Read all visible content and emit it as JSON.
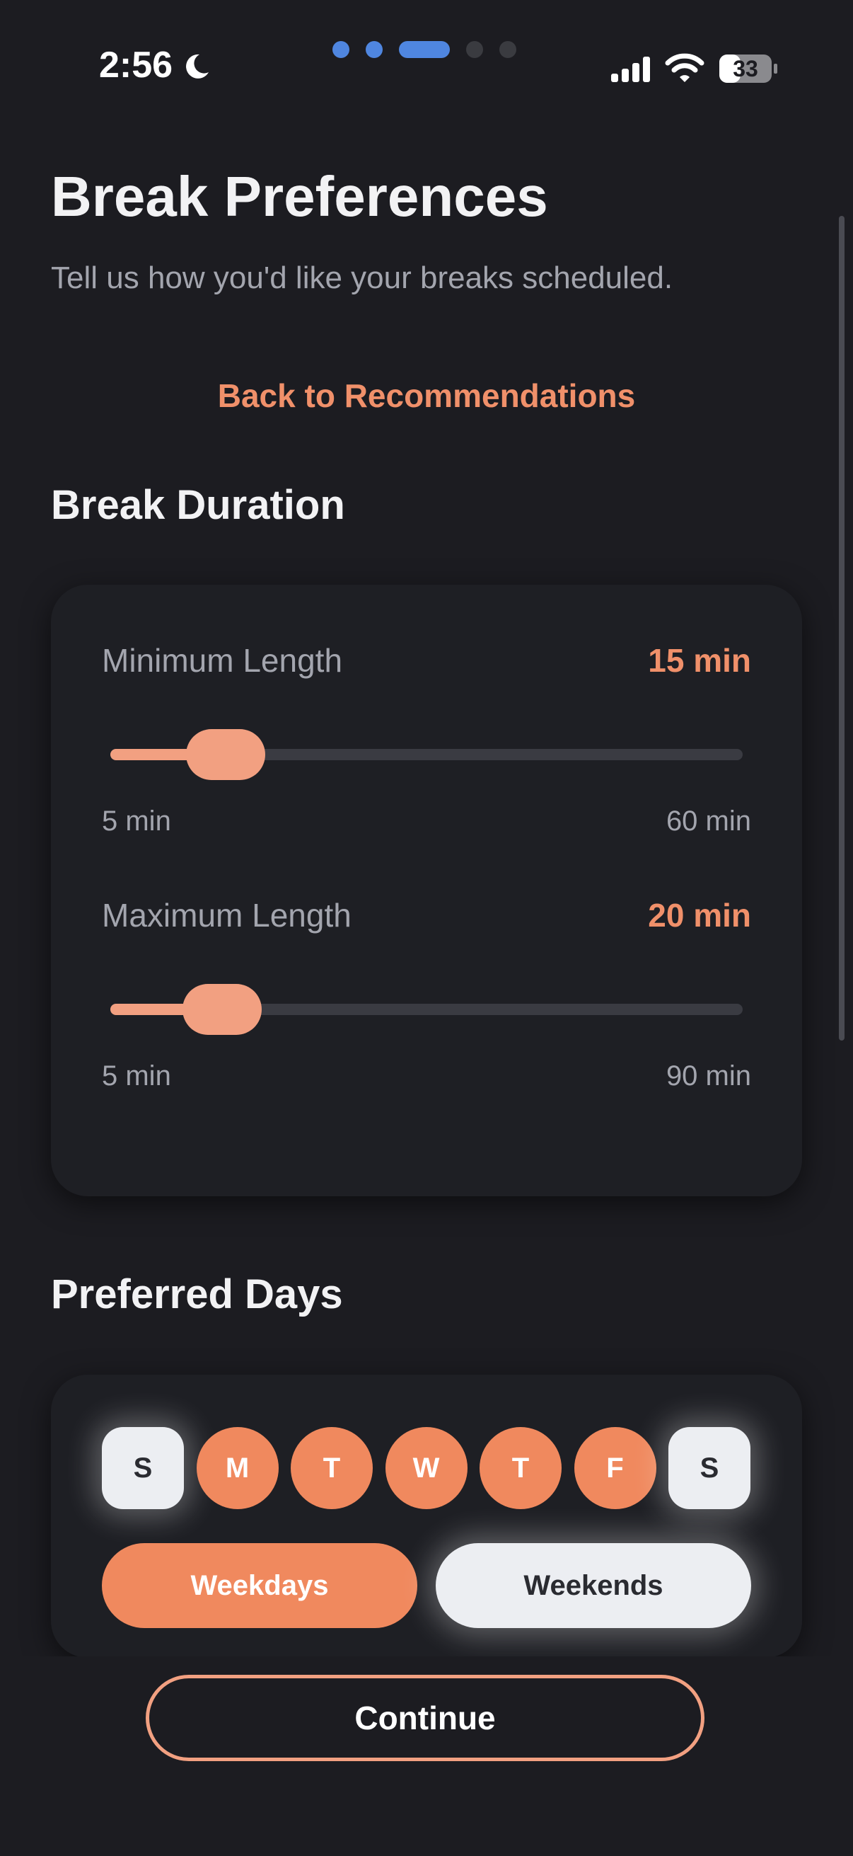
{
  "status_bar": {
    "time": "2:56",
    "battery": "33",
    "pager": [
      "done",
      "done",
      "active",
      "todo",
      "todo"
    ]
  },
  "header": {
    "title": "Break Preferences",
    "subtitle": "Tell us how you'd like your breaks scheduled.",
    "back_link": "Back to Recommendations"
  },
  "break_duration": {
    "section_title": "Break Duration",
    "minimum": {
      "label": "Minimum Length",
      "value": "15 min",
      "current": 15,
      "min": 5,
      "max": 60,
      "min_label": "5 min",
      "max_label": "60 min"
    },
    "maximum": {
      "label": "Maximum Length",
      "value": "20 min",
      "current": 20,
      "min": 5,
      "max": 90,
      "min_label": "5 min",
      "max_label": "90 min"
    }
  },
  "preferred_days": {
    "section_title": "Preferred Days",
    "days": [
      {
        "letter": "S",
        "selected": false
      },
      {
        "letter": "M",
        "selected": true
      },
      {
        "letter": "T",
        "selected": true
      },
      {
        "letter": "W",
        "selected": true
      },
      {
        "letter": "T",
        "selected": true
      },
      {
        "letter": "F",
        "selected": true
      },
      {
        "letter": "S",
        "selected": false
      }
    ],
    "weekdays_label": "Weekdays",
    "weekends_label": "Weekends"
  },
  "footer": {
    "continue_label": "Continue"
  },
  "colors": {
    "background": "#1c1c21",
    "accent": "#f0895e",
    "slider": "#f2a081",
    "pager_active": "#4f86e0"
  }
}
